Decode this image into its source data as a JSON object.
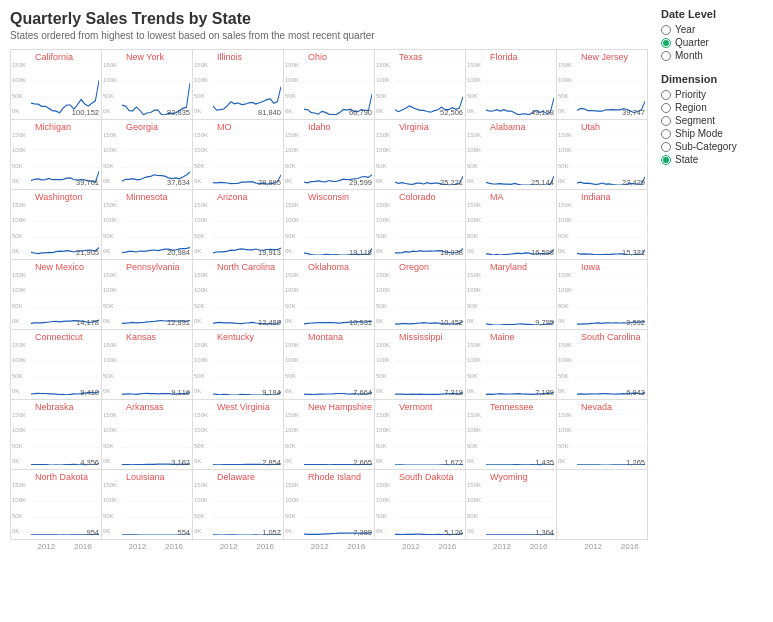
{
  "title": "Quarterly Sales Trends by State",
  "subtitle": "States ordered from highest to lowest based on sales from the most recent quarter",
  "sidebar": {
    "date_level_label": "Date Level",
    "date_options": [
      "Year",
      "Quarter",
      "Month"
    ],
    "date_selected": "Quarter",
    "dimension_label": "Dimension",
    "dimension_options": [
      "Priority",
      "Region",
      "Segment",
      "Ship Mode",
      "Sub-Category",
      "State"
    ],
    "dimension_selected": "State"
  },
  "y_labels": [
    "150K",
    "100K",
    "50K",
    "0K"
  ],
  "x_labels": [
    "2012",
    "2016"
  ],
  "states": [
    {
      "name": "California",
      "value": "100,152",
      "row": 0
    },
    {
      "name": "New York",
      "value": "92,835",
      "row": 0
    },
    {
      "name": "Illinois",
      "value": "81,840",
      "row": 0
    },
    {
      "name": "Ohio",
      "value": "60,790",
      "row": 0
    },
    {
      "name": "Texas",
      "value": "52,506",
      "row": 0
    },
    {
      "name": "Florida",
      "value": "49,158",
      "row": 0
    },
    {
      "name": "New Jersey",
      "value": "39,747",
      "row": 0
    },
    {
      "name": "Michigan",
      "value": "39,701",
      "row": 1
    },
    {
      "name": "Georgia",
      "value": "37,634",
      "row": 1
    },
    {
      "name": "MO",
      "value": "28,885",
      "row": 1
    },
    {
      "name": "Idaho",
      "value": "29,599",
      "row": 1
    },
    {
      "name": "Virginia",
      "value": "25,221",
      "row": 1
    },
    {
      "name": "Alabama",
      "value": "25,144",
      "row": 1
    },
    {
      "name": "Utah",
      "value": "23,429",
      "row": 1
    },
    {
      "name": "Washington",
      "value": "21,905",
      "row": 2
    },
    {
      "name": "Minnesota",
      "value": "20,984",
      "row": 2
    },
    {
      "name": "Arizona",
      "value": "19,913",
      "row": 2
    },
    {
      "name": "Wisconsin",
      "value": "19,118",
      "row": 2
    },
    {
      "name": "Colorado",
      "value": "18,938",
      "row": 2
    },
    {
      "name": "MA",
      "value": "16,598",
      "row": 2
    },
    {
      "name": "Indiana",
      "value": "15,331",
      "row": 2
    },
    {
      "name": "New Mexico",
      "value": "14,178",
      "row": 3
    },
    {
      "name": "Pennsylvania",
      "value": "12,891",
      "row": 3
    },
    {
      "name": "North Carolina",
      "value": "12,480",
      "row": 3
    },
    {
      "name": "Oklahoma",
      "value": "10,531",
      "row": 3
    },
    {
      "name": "Oregon",
      "value": "10,452",
      "row": 3
    },
    {
      "name": "Maryland",
      "value": "9,795",
      "row": 3
    },
    {
      "name": "Iowa",
      "value": "9,592",
      "row": 3
    },
    {
      "name": "Connecticut",
      "value": "9,410",
      "row": 4
    },
    {
      "name": "Kansas",
      "value": "9,116",
      "row": 4
    },
    {
      "name": "Kentucky",
      "value": "9,184",
      "row": 4
    },
    {
      "name": "Montana",
      "value": "7,664",
      "row": 4
    },
    {
      "name": "Mississippi",
      "value": "7,318",
      "row": 4
    },
    {
      "name": "Maine",
      "value": "7,189",
      "row": 4
    },
    {
      "name": "South Carolina",
      "value": "6,943",
      "row": 4
    },
    {
      "name": "Nebraska",
      "value": "4,356",
      "row": 5
    },
    {
      "name": "Arkansas",
      "value": "3,162",
      "row": 5
    },
    {
      "name": "West Virginia",
      "value": "2,854",
      "row": 5
    },
    {
      "name": "New Hampshire",
      "value": "2,665",
      "row": 5
    },
    {
      "name": "Vermont",
      "value": "1,672",
      "row": 5
    },
    {
      "name": "Tennessee",
      "value": "1,435",
      "row": 5
    },
    {
      "name": "Nevada",
      "value": "1,265",
      "row": 5
    },
    {
      "name": "North Dakota",
      "value": "954",
      "row": 6
    },
    {
      "name": "Louisiana",
      "value": "554",
      "row": 6
    },
    {
      "name": "Delaware",
      "value": "1,057",
      "row": 6
    },
    {
      "name": "Rhode Island",
      "value": "7,389",
      "row": 6
    },
    {
      "name": "South Dakota",
      "value": "5,126",
      "row": 6
    },
    {
      "name": "Wyoming",
      "value": "1,364",
      "row": 6
    },
    {
      "name": "",
      "value": "",
      "row": 6
    }
  ]
}
